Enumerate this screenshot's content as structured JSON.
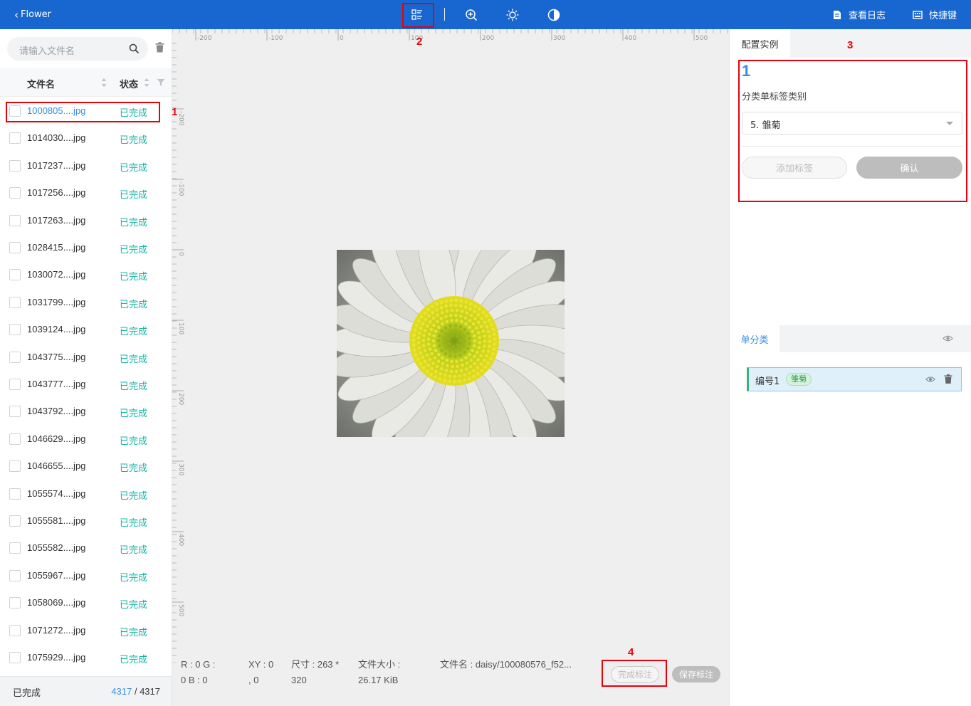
{
  "topbar": {
    "back_label": "Flower",
    "log_label": "查看日志",
    "shortcut_label": "快捷键",
    "icons": [
      "list-layout-icon",
      "zoom-in-icon",
      "brightness-icon",
      "contrast-icon"
    ]
  },
  "left": {
    "search_placeholder": "请输入文件名",
    "col_filename": "文件名",
    "col_status": "状态",
    "files": [
      {
        "name": "1000805....jpg",
        "status": "已完成"
      },
      {
        "name": "1014030....jpg",
        "status": "已完成"
      },
      {
        "name": "1017237....jpg",
        "status": "已完成"
      },
      {
        "name": "1017256....jpg",
        "status": "已完成"
      },
      {
        "name": "1017263....jpg",
        "status": "已完成"
      },
      {
        "name": "1028415....jpg",
        "status": "已完成"
      },
      {
        "name": "1030072....jpg",
        "status": "已完成"
      },
      {
        "name": "1031799....jpg",
        "status": "已完成"
      },
      {
        "name": "1039124....jpg",
        "status": "已完成"
      },
      {
        "name": "1043775....jpg",
        "status": "已完成"
      },
      {
        "name": "1043777....jpg",
        "status": "已完成"
      },
      {
        "name": "1043792....jpg",
        "status": "已完成"
      },
      {
        "name": "1046629....jpg",
        "status": "已完成"
      },
      {
        "name": "1046655....jpg",
        "status": "已完成"
      },
      {
        "name": "1055574....jpg",
        "status": "已完成"
      },
      {
        "name": "1055581....jpg",
        "status": "已完成"
      },
      {
        "name": "1055582....jpg",
        "status": "已完成"
      },
      {
        "name": "1055967....jpg",
        "status": "已完成"
      },
      {
        "name": "1058069....jpg",
        "status": "已完成"
      },
      {
        "name": "1071272....jpg",
        "status": "已完成"
      },
      {
        "name": "1075929....jpg",
        "status": "已完成"
      }
    ],
    "footer_label": "已完成",
    "footer_done": "4317",
    "footer_sep": " / ",
    "footer_total": "4317"
  },
  "canvas": {
    "ruler_h_labels": [
      "-200",
      "-100",
      "0",
      "100",
      "200",
      "300",
      "400",
      "500"
    ],
    "ruler_v_labels": [
      "-200",
      "-100",
      "0",
      "100",
      "200",
      "300",
      "400",
      "500"
    ],
    "rgb_line1": "R : 0   G :",
    "rgb_line2": "0   B : 0",
    "xy_line1": "XY : 0",
    "xy_line2": ", 0",
    "size_line1": "尺寸 : 263 *",
    "size_line2": "320",
    "filesize_line1": "文件大小 :",
    "filesize_line2": "26.17 KiB",
    "filename": "文件名 : daisy/100080576_f52...",
    "btn_done": "完成标注",
    "btn_save": "保存标注"
  },
  "right": {
    "tab_config": "配置实例",
    "instance_number": "1",
    "category_label": "分类单标签类别",
    "selected_category": "5. 雏菊",
    "btn_add": "添加标签",
    "btn_confirm": "确认",
    "tab_single": "单分类",
    "item_title": "编号1",
    "item_tag": "雏菊"
  },
  "annotations": {
    "n1": "1",
    "n2": "2",
    "n3": "3",
    "n4": "4",
    "color": "#e8000b"
  },
  "colors": {
    "topbar": "#1867d0",
    "accent": "#3a8ee6",
    "status_done": "#14b3a3"
  }
}
